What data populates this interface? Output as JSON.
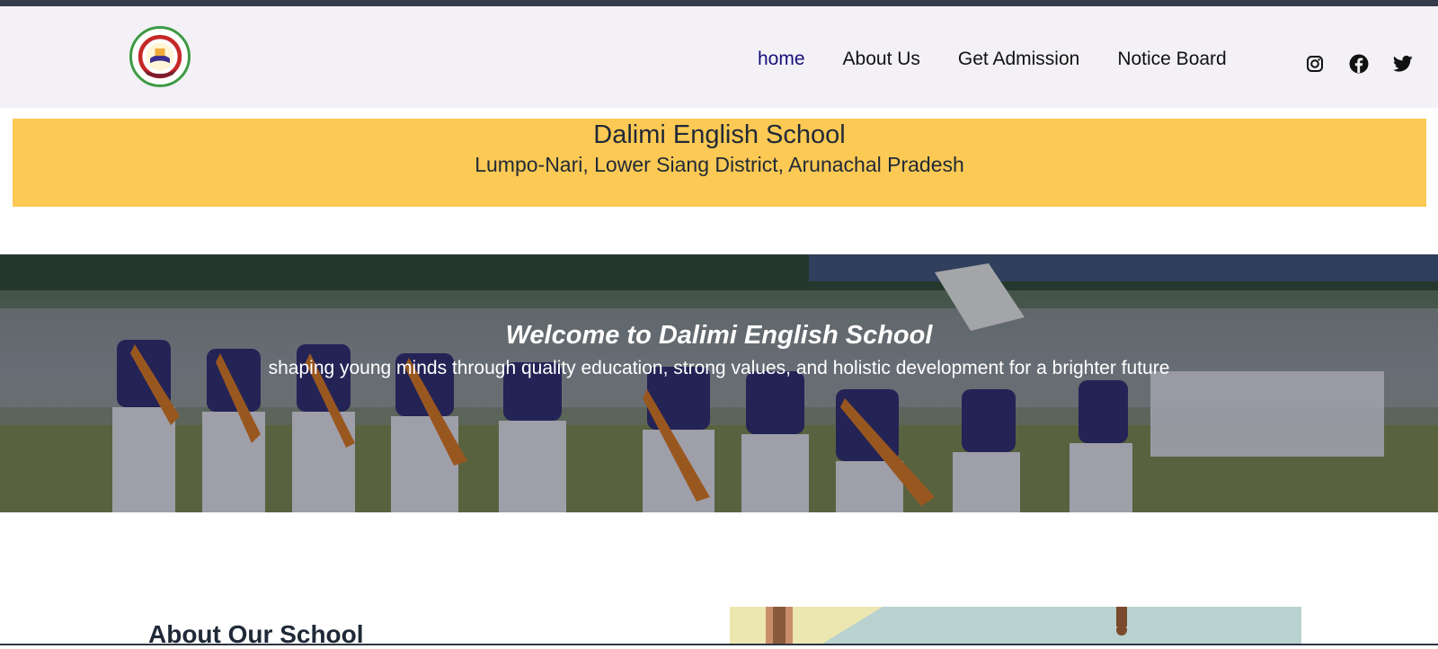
{
  "navbar": {
    "links": [
      {
        "label": "home",
        "active": true
      },
      {
        "label": "About Us",
        "active": false
      },
      {
        "label": "Get Admission",
        "active": false
      },
      {
        "label": "Notice Board",
        "active": false
      }
    ],
    "socials": [
      "instagram-icon",
      "facebook-icon",
      "twitter-icon"
    ],
    "active_color": "#16107a"
  },
  "logo": {
    "ring_text": "DALIMI ENGLISH SCHOOL",
    "bottom_text": "LUMPO-NARI"
  },
  "banner": {
    "title": "Dalimi English School",
    "subtitle": "Lumpo-Nari, Lower Siang District, Arunachal Pradesh",
    "color": "#fcc954"
  },
  "hero": {
    "title": "Welcome to Dalimi English School",
    "subtitle": "shaping young minds through quality education, strong values, and holistic development for a brighter future"
  },
  "about": {
    "title": "About Our School"
  }
}
